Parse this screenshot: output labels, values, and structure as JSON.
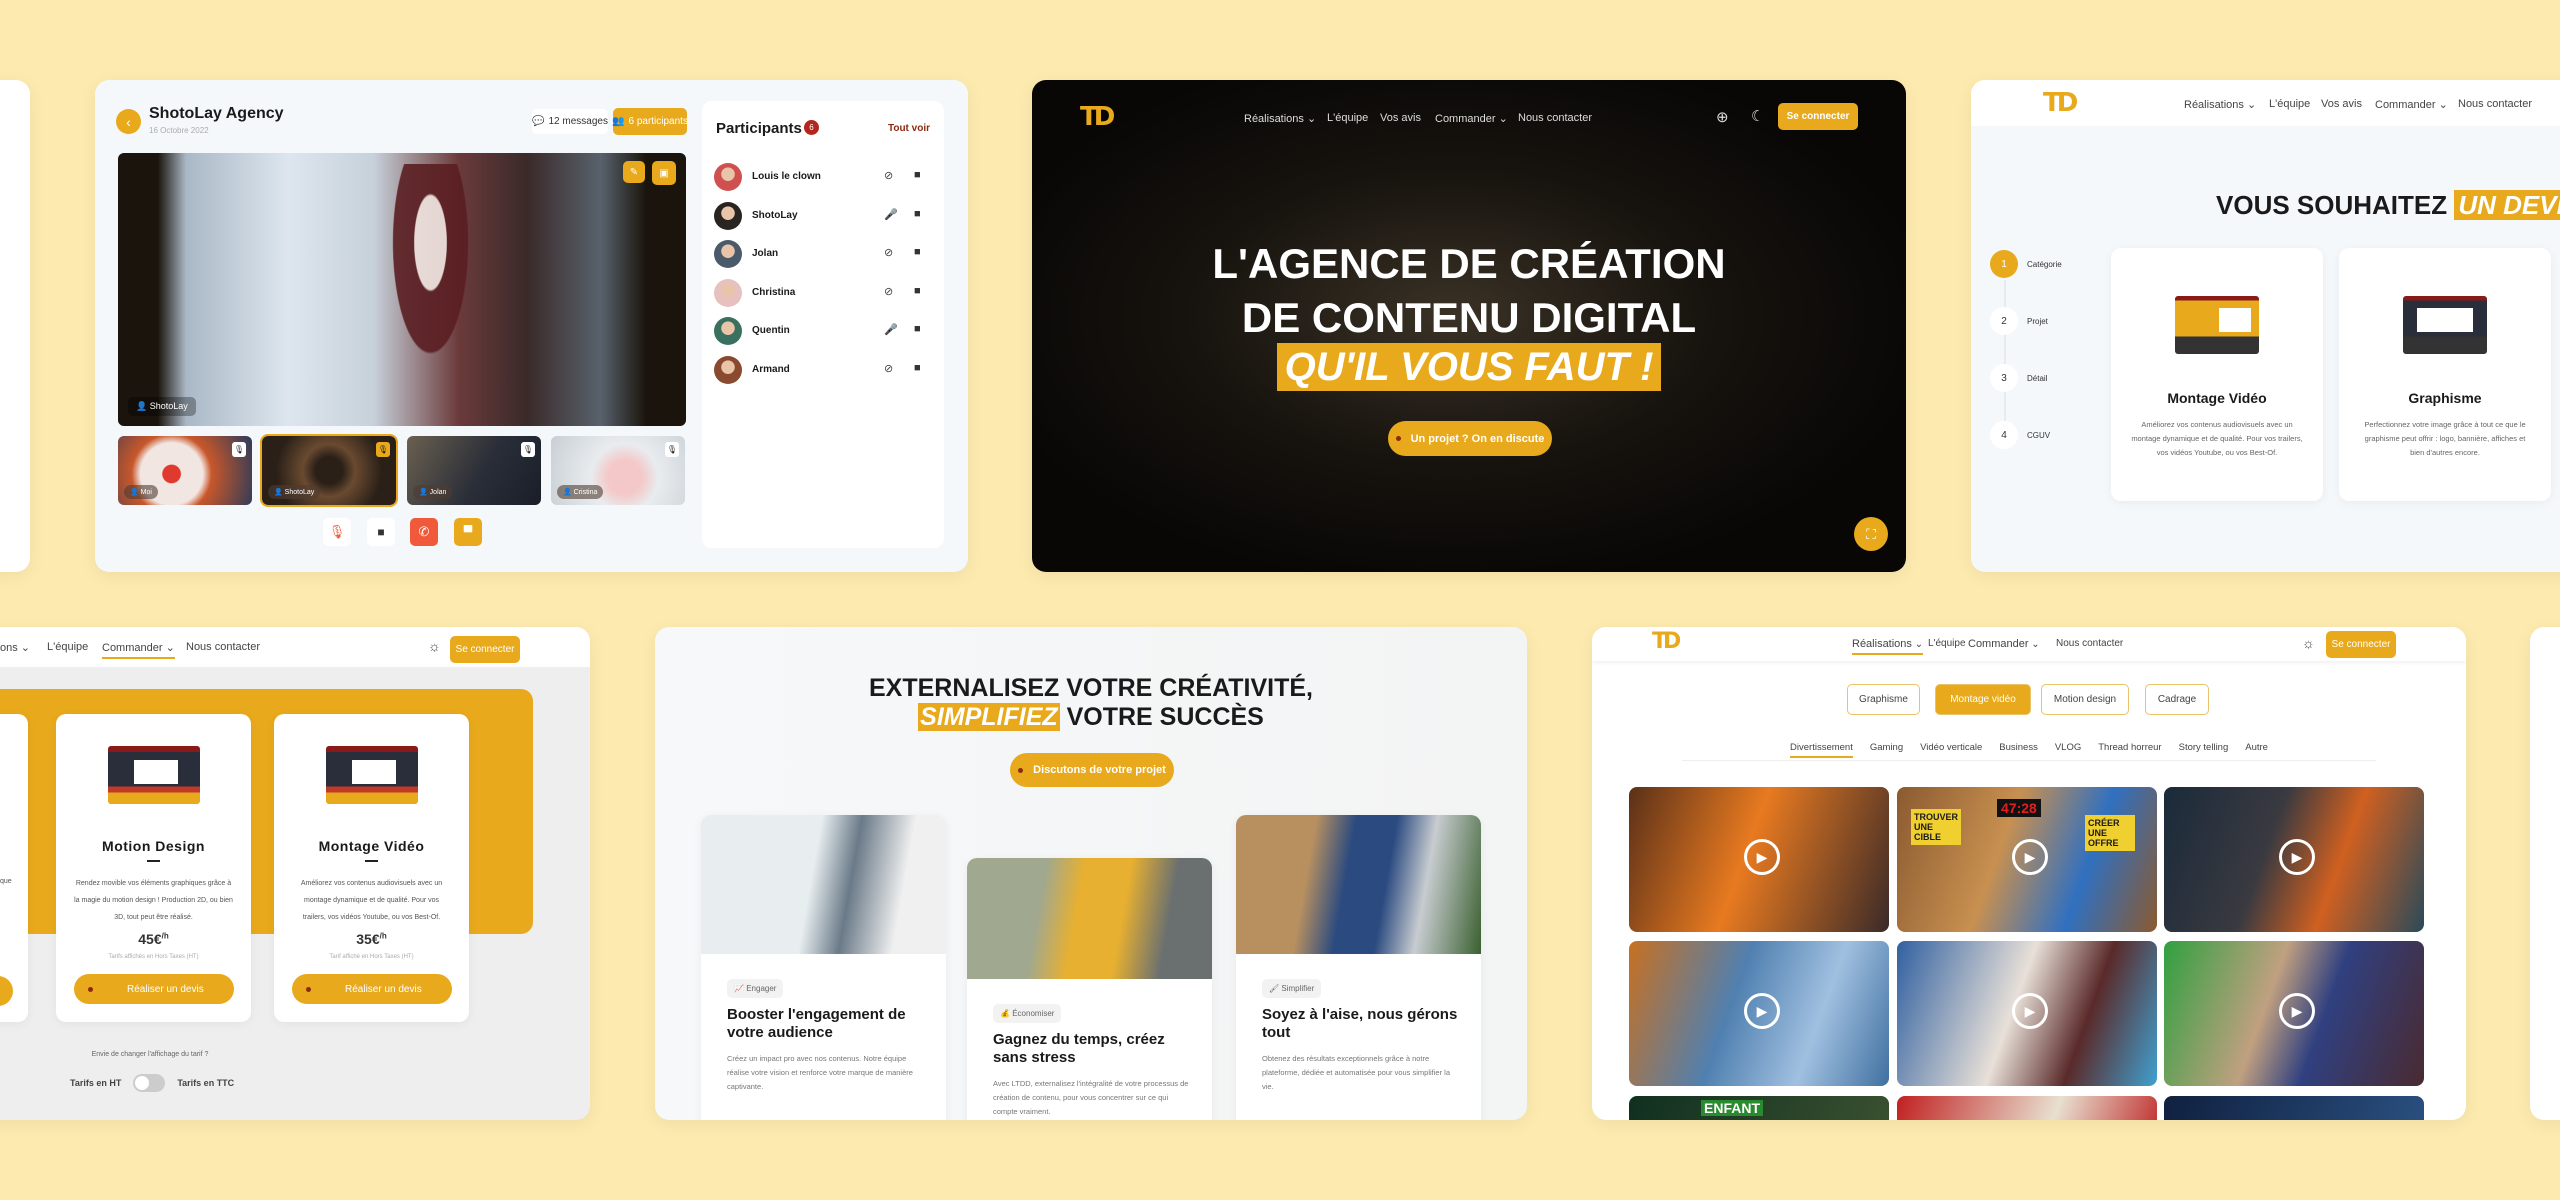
{
  "colors": {
    "accent": "#E8A91C",
    "background": "#FCEAAF",
    "danger": "#F05A3A",
    "badge": "#B3261E"
  },
  "call": {
    "title": "ShotoLay Agency",
    "date": "16 Octobre 2022",
    "messages": "12 messages",
    "participants_btn": "6 participants",
    "speaker": "ShotoLay",
    "panel_title": "Participants",
    "count": "6",
    "see_all": "Tout voir",
    "participants": [
      {
        "name": "Louis le clown",
        "mic": "off",
        "cam": "off"
      },
      {
        "name": "ShotoLay",
        "mic": "active",
        "cam": "on"
      },
      {
        "name": "Jolan",
        "mic": "off",
        "cam": "on"
      },
      {
        "name": "Christina",
        "mic": "off",
        "cam": "on"
      },
      {
        "name": "Quentin",
        "mic": "on",
        "cam": "on"
      },
      {
        "name": "Armand",
        "mic": "off",
        "cam": "on"
      }
    ],
    "thumbs": [
      {
        "name": "Moi"
      },
      {
        "name": "ShotoLay"
      },
      {
        "name": "Jolan"
      },
      {
        "name": "Cristina"
      }
    ]
  },
  "nav": {
    "realisations": "Réalisations",
    "equipe": "L'équipe",
    "avis": "Vos avis",
    "commander": "Commander",
    "contact": "Nous contacter",
    "login": "Se connecter",
    "partial": "ons"
  },
  "hero": {
    "line1": "L'AGENCE DE CRÉATION",
    "line2": "DE CONTENU DIGITAL",
    "line3": "QU'IL VOUS FAUT !",
    "cta": "Un projet ? On en discute"
  },
  "devis": {
    "title_a": "VOUS SOUHAITEZ",
    "title_b": "UN DEVIS",
    "steps": [
      {
        "n": "1",
        "label": "Catégorie"
      },
      {
        "n": "2",
        "label": "Projet"
      },
      {
        "n": "3",
        "label": "Détail"
      },
      {
        "n": "4",
        "label": "CGUV"
      }
    ],
    "cards": [
      {
        "title": "Montage Vidéo",
        "desc": "Améliorez vos contenus audiovisuels avec un montage dynamique et de qualité. Pour vos trailers, vos vidéos Youtube, ou vos Best-Of."
      },
      {
        "title": "Graphisme",
        "desc": "Perfectionnez votre image grâce à tout ce que le graphisme peut offrir : logo, bannière, affiches et bien d'autres encore."
      }
    ]
  },
  "pricing": {
    "partial_desc": "que",
    "cards": [
      {
        "title": "Motion Design",
        "desc": "Rendez movible vos éléments graphiques grâce à la magie du motion design ! Production 2D, ou bien 3D, tout peut être réalisé.",
        "price": "45€",
        "unit": "/h",
        "note": "Tarifs affichés en Hors Taxes (HT)",
        "cta": "Réaliser un devis"
      },
      {
        "title": "Montage Vidéo",
        "desc": "Améliorez vos contenus audiovisuels avec un montage dynamique et de qualité. Pour vos trailers, vos vidéos Youtube, ou vos Best-Of.",
        "price": "35€",
        "unit": "/h",
        "note": "Tarif affiché en Hors Taxes (HT)",
        "cta": "Réaliser un devis"
      }
    ],
    "toggle_q": "Envie de changer l'affichage du tarif ?",
    "ht": "Tarifs en HT",
    "ttc": "Tarifs en TTC",
    "ttc_on": false
  },
  "features": {
    "title_1": "EXTERNALISEZ VOTRE CRÉATIVITÉ,",
    "title_hl": "SIMPLIFIEZ",
    "title_2": "VOTRE SUCCÈS",
    "cta": "Discutons de votre projet",
    "cards": [
      {
        "badge": "Engager",
        "title": "Booster l'engagement de votre audience",
        "desc": "Créez un impact pro avec nos contenus. Notre équipe réalise votre vision et renforce votre marque de manière captivante."
      },
      {
        "badge": "Économiser",
        "title": "Gagnez du temps, créez sans stress",
        "desc": "Avec LTDD, externalisez l'intégralité de votre processus de création de contenu, pour vous concentrer sur ce qui compte vraiment."
      },
      {
        "badge": "Simplifier",
        "title": "Soyez à l'aise, nous gérons tout",
        "desc": "Obtenez des résultats exceptionnels grâce à notre plateforme, dédiée et automatisée pour vous simplifier la vie."
      }
    ]
  },
  "portfolio": {
    "filters": [
      "Graphisme",
      "Montage vidéo",
      "Motion design",
      "Cadrage"
    ],
    "active_filter": "Montage vidéo",
    "subtabs": [
      "Divertissement",
      "Gaming",
      "Vidéo verticale",
      "Business",
      "VLOG",
      "Thread horreur",
      "Story telling",
      "Autre"
    ],
    "active_subtab": "Divertissement",
    "thumb_texts": [
      "TROUVER UNE CIBLE",
      "47:28",
      "CRÉER UNE OFFRE",
      "ENFANT"
    ]
  }
}
